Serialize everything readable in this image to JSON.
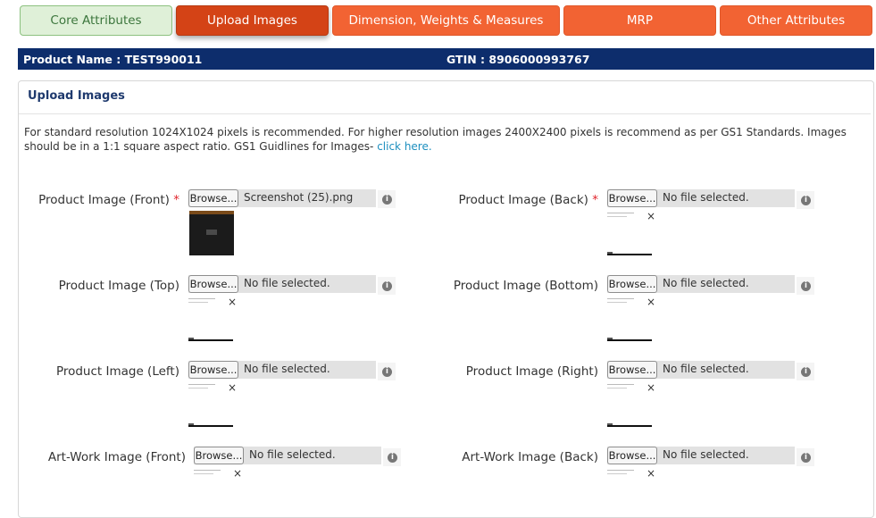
{
  "tabs": [
    {
      "label": "Core Attributes"
    },
    {
      "label": "Upload Images"
    },
    {
      "label": "Dimension, Weights & Measures"
    },
    {
      "label": "MRP"
    },
    {
      "label": "Other Attributes"
    }
  ],
  "header": {
    "product_name": "Product Name : TEST990011",
    "gtin": "GTIN : 8906000993767"
  },
  "section": {
    "title": "Upload Images",
    "note": "For standard resolution 1024X1024 pixels is recommended. For higher resolution images 2400X2400 pixels is recommend as per GS1 Standards. Images should be in a 1:1 square aspect ratio. GS1 Guidlines for Images-",
    "link": "click here."
  },
  "fields": [
    {
      "label": "Product Image (Front)",
      "required": "*",
      "browse": "Browse...",
      "file": "Screenshot (25).png",
      "info": "i",
      "remove": "×"
    },
    {
      "label": "Product Image (Back)",
      "required": "*",
      "browse": "Browse...",
      "file": "No file selected.",
      "info": "i",
      "remove": "×"
    },
    {
      "label": "Product Image (Top)",
      "required": "",
      "browse": "Browse...",
      "file": "No file selected.",
      "info": "i",
      "remove": "×"
    },
    {
      "label": "Product Image (Bottom)",
      "required": "",
      "browse": "Browse...",
      "file": "No file selected.",
      "info": "i",
      "remove": "×"
    },
    {
      "label": "Product Image (Left)",
      "required": "",
      "browse": "Browse...",
      "file": "No file selected.",
      "info": "i",
      "remove": "×"
    },
    {
      "label": "Product Image (Right)",
      "required": "",
      "browse": "Browse...",
      "file": "No file selected.",
      "info": "i",
      "remove": "×"
    },
    {
      "label": "Art-Work Image (Front)",
      "required": "",
      "browse": "Browse...",
      "file": "No file selected.",
      "info": "i",
      "remove": "×"
    },
    {
      "label": "Art-Work Image (Back)",
      "required": "",
      "browse": "Browse...",
      "file": "No file selected.",
      "info": "i",
      "remove": "×"
    }
  ]
}
